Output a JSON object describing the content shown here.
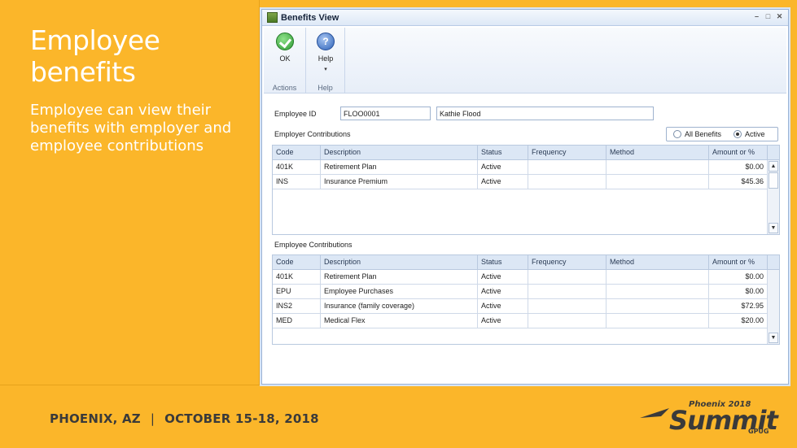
{
  "slide": {
    "title": "Employee benefits",
    "subtitle": "Employee can view their benefits with employer and employee contributions"
  },
  "footer": {
    "location": "PHOENIX, AZ",
    "separator": "|",
    "dates": "OCTOBER 15-18, 2018",
    "logo_top": "Phoenix 2018",
    "logo_main": "Summit",
    "logo_sub": "GPUG"
  },
  "window": {
    "title": "Benefits View",
    "controls": [
      "–",
      "□",
      "✕"
    ]
  },
  "ribbon": {
    "actions": {
      "button": "OK",
      "group": "Actions",
      "icon": "ok-check-icon"
    },
    "help": {
      "button": "Help",
      "caret": "▾",
      "group": "Help",
      "icon": "help-icon"
    }
  },
  "form": {
    "employee_id_label": "Employee ID",
    "employee_id": "FLOO0001",
    "employee_name": "Kathie Flood",
    "employer_section": "Employer Contributions",
    "employee_section": "Employee Contributions",
    "filter": {
      "options": [
        "All Benefits",
        "Active"
      ],
      "selected": "Active"
    }
  },
  "columns": {
    "code": "Code",
    "description": "Description",
    "status": "Status",
    "frequency": "Frequency",
    "method": "Method",
    "amount": "Amount or %"
  },
  "employer_rows": [
    {
      "code": "401K",
      "description": "Retirement Plan",
      "status": "Active",
      "frequency": "",
      "method": "",
      "amount": "$0.00"
    },
    {
      "code": "INS",
      "description": "Insurance Premium",
      "status": "Active",
      "frequency": "",
      "method": "",
      "amount": "$45.36"
    }
  ],
  "employee_rows": [
    {
      "code": "401K",
      "description": "Retirement Plan",
      "status": "Active",
      "frequency": "",
      "method": "",
      "amount": "$0.00"
    },
    {
      "code": "EPU",
      "description": "Employee Purchases",
      "status": "Active",
      "frequency": "",
      "method": "",
      "amount": "$0.00"
    },
    {
      "code": "INS2",
      "description": "Insurance (family coverage)",
      "status": "Active",
      "frequency": "",
      "method": "",
      "amount": "$72.95"
    },
    {
      "code": "MED",
      "description": "Medical Flex",
      "status": "Active",
      "frequency": "",
      "method": "",
      "amount": "$20.00"
    }
  ],
  "scroll": {
    "up": "▲",
    "down": "▼"
  },
  "colors": {
    "background": "#fbb62a",
    "window_border": "#9ab3d6",
    "grid_header": "#dce7f5"
  }
}
